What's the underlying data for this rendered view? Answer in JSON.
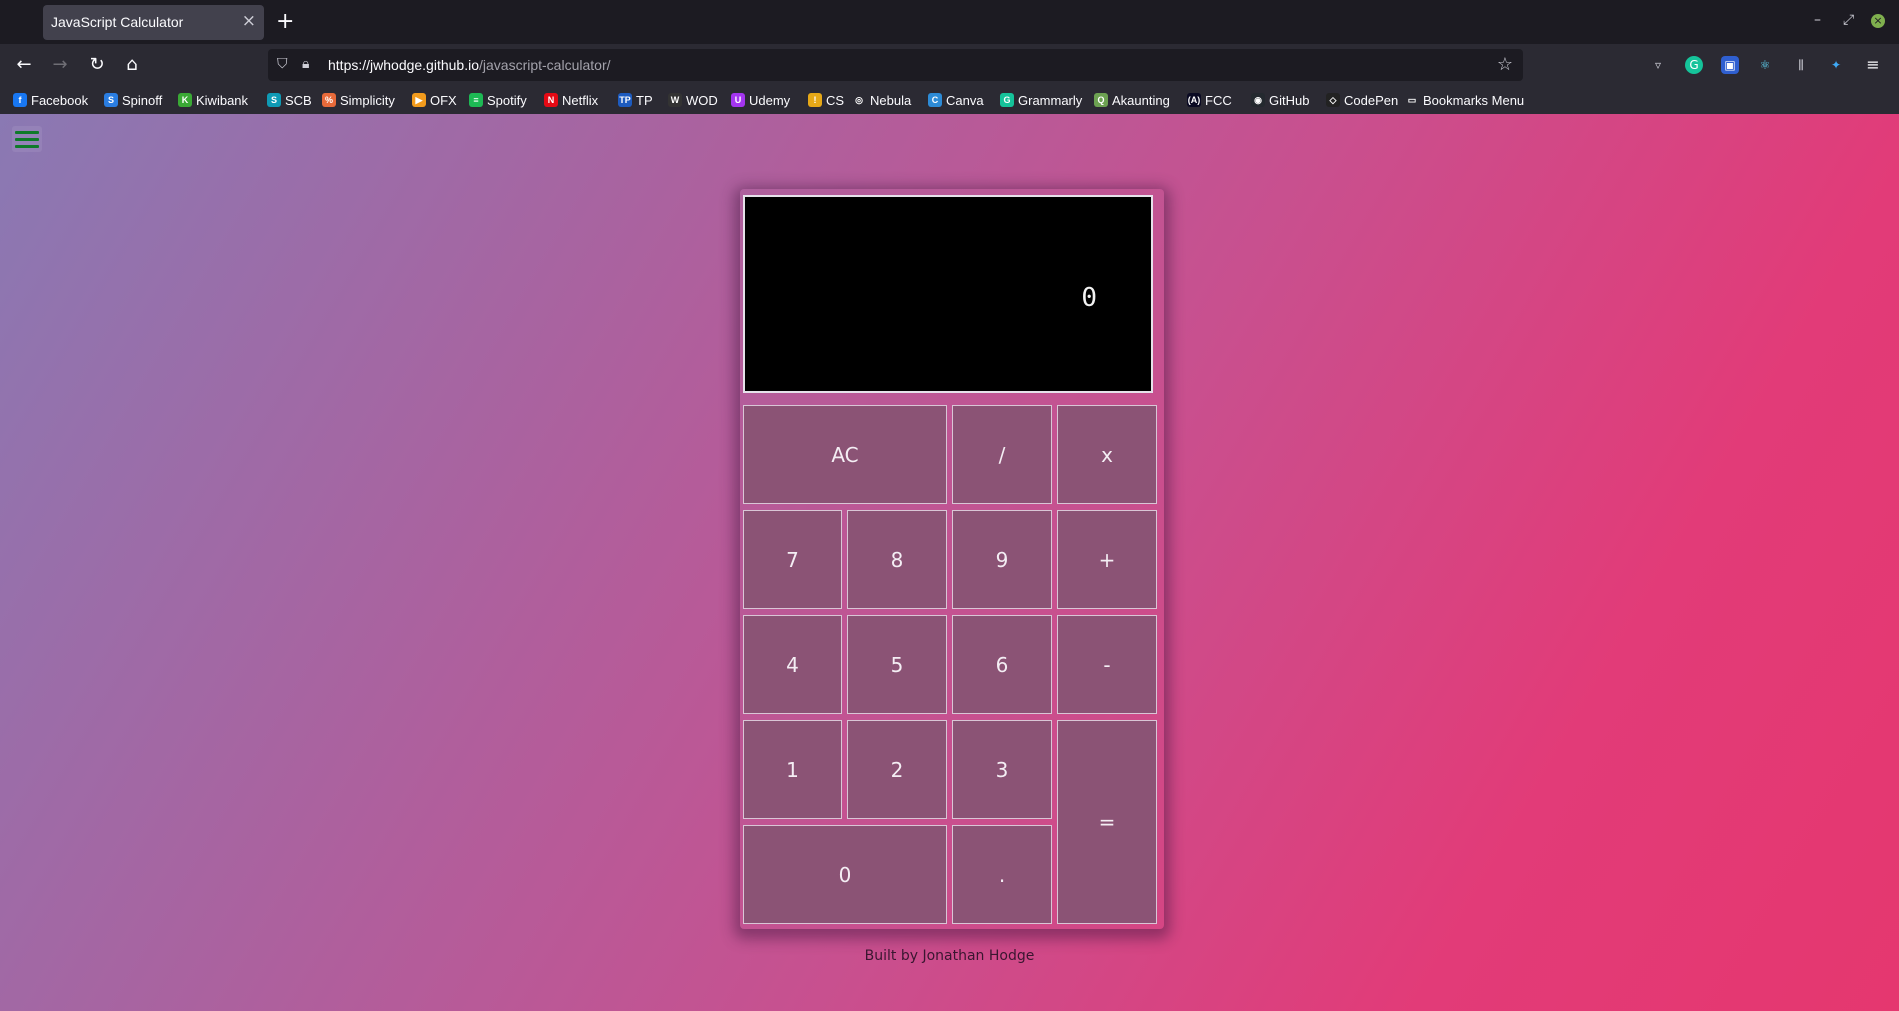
{
  "browser": {
    "tab_title": "JavaScript Calculator",
    "tab_close": "×",
    "new_tab": "+",
    "url_host": "https://jwhodge.github.io",
    "url_path": "/javascript-calculator/",
    "bookmarks": [
      {
        "label": "Facebook",
        "icon": "facebook-icon",
        "color": "#1877f2",
        "glyph": "f"
      },
      {
        "label": "Spinoff",
        "icon": "spinoff-icon",
        "color": "#2a7de1",
        "glyph": "S"
      },
      {
        "label": "Kiwibank",
        "icon": "kiwibank-icon",
        "color": "#3aa935",
        "glyph": "K"
      },
      {
        "label": "SCB",
        "icon": "scb-icon",
        "color": "#0f9ab5",
        "glyph": "S"
      },
      {
        "label": "Simplicity",
        "icon": "simplicity-icon",
        "color": "#e86a3a",
        "glyph": "%"
      },
      {
        "label": "OFX",
        "icon": "ofx-icon",
        "color": "#f29b1d",
        "glyph": "▶"
      },
      {
        "label": "Spotify",
        "icon": "spotify-icon",
        "color": "#1db954",
        "glyph": "≡"
      },
      {
        "label": "Netflix",
        "icon": "netflix-icon",
        "color": "#e50914",
        "glyph": "N"
      },
      {
        "label": "TP",
        "icon": "tp-icon",
        "color": "#1d5bbf",
        "glyph": "TP"
      },
      {
        "label": "WOD",
        "icon": "wod-icon",
        "color": "#333333",
        "glyph": "W"
      },
      {
        "label": "Udemy",
        "icon": "udemy-icon",
        "color": "#a435f0",
        "glyph": "U"
      },
      {
        "label": "CS",
        "icon": "cs-icon",
        "color": "#e6a817",
        "glyph": "!"
      },
      {
        "label": "Nebula",
        "icon": "globe-icon",
        "color": "#2b2a33",
        "glyph": "◎"
      },
      {
        "label": "Canva",
        "icon": "canva-icon",
        "color": "#2d8bd6",
        "glyph": "C"
      },
      {
        "label": "Grammarly",
        "icon": "grammarly-icon",
        "color": "#15c39a",
        "glyph": "G"
      },
      {
        "label": "Akaunting",
        "icon": "akaunting-icon",
        "color": "#6da252",
        "glyph": "Q"
      },
      {
        "label": "FCC",
        "icon": "fcc-icon",
        "color": "#0a0a23",
        "glyph": "(A)"
      },
      {
        "label": "GitHub",
        "icon": "github-icon",
        "color": "#24292f",
        "glyph": "◉"
      },
      {
        "label": "CodePen",
        "icon": "codepen-icon",
        "color": "#222222",
        "glyph": "◇"
      },
      {
        "label": "Bookmarks Menu",
        "icon": "folder-icon",
        "color": "#2b2a33",
        "glyph": "▭"
      }
    ]
  },
  "calculator": {
    "display": "0",
    "keys": {
      "clear": "AC",
      "divide": "/",
      "multiply": "x",
      "seven": "7",
      "eight": "8",
      "nine": "9",
      "add": "+",
      "four": "4",
      "five": "5",
      "six": "6",
      "subtract": "-",
      "one": "1",
      "two": "2",
      "three": "3",
      "equals": "=",
      "zero": "0",
      "decimal": "."
    }
  },
  "footer": {
    "credit": "Built by Jonathan Hodge"
  }
}
